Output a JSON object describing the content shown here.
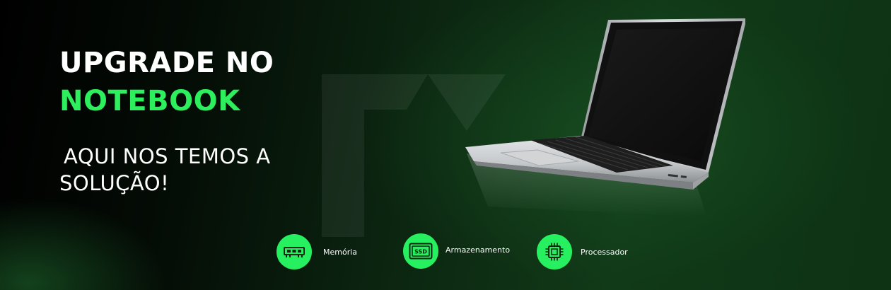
{
  "headline": {
    "line1": "UPGRADE NO",
    "line2": "NOTEBOOK"
  },
  "subline": {
    "line1": "AQUI NOS TEMOS A",
    "line2": "SOLUÇÃO!"
  },
  "features": [
    {
      "label": "Memória",
      "icon": "ram-memory-icon"
    },
    {
      "label": "Armazenamento",
      "icon": "ssd-icon"
    },
    {
      "label": "Processador",
      "icon": "processor-chip-icon"
    }
  ],
  "colors": {
    "accent": "#2dee5c",
    "badge": "#27f060",
    "text": "#ffffff",
    "background_dark": "#000000",
    "background_green": "#113a18"
  }
}
